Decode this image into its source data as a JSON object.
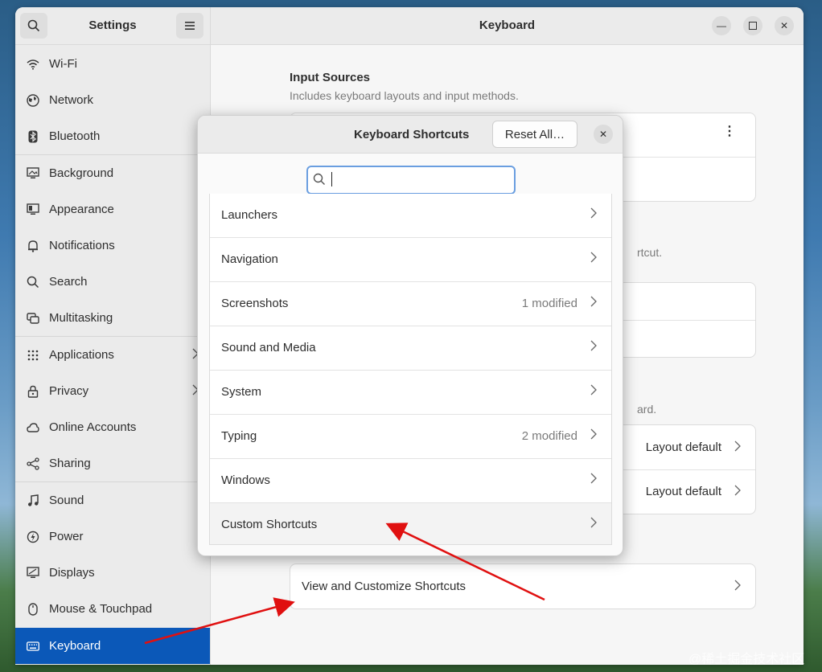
{
  "settings": {
    "sidebar_title": "Settings",
    "items": [
      {
        "label": "Wi-Fi",
        "icon": "wifi-icon"
      },
      {
        "label": "Network",
        "icon": "network-icon"
      },
      {
        "label": "Bluetooth",
        "icon": "bluetooth-icon"
      },
      {
        "label": "Background",
        "icon": "background-icon"
      },
      {
        "label": "Appearance",
        "icon": "appearance-icon"
      },
      {
        "label": "Notifications",
        "icon": "bell-icon"
      },
      {
        "label": "Search",
        "icon": "search-icon"
      },
      {
        "label": "Multitasking",
        "icon": "multitasking-icon"
      },
      {
        "label": "Applications",
        "icon": "grid-icon"
      },
      {
        "label": "Privacy",
        "icon": "lock-icon"
      },
      {
        "label": "Online Accounts",
        "icon": "cloud-icon"
      },
      {
        "label": "Sharing",
        "icon": "share-icon"
      },
      {
        "label": "Sound",
        "icon": "music-note-icon"
      },
      {
        "label": "Power",
        "icon": "power-icon"
      },
      {
        "label": "Displays",
        "icon": "display-icon"
      },
      {
        "label": "Mouse & Touchpad",
        "icon": "mouse-icon"
      },
      {
        "label": "Keyboard",
        "icon": "keyboard-icon"
      }
    ]
  },
  "main": {
    "title": "Keyboard",
    "input_sources_title": "Input Sources",
    "input_sources_subtitle": "Includes keyboard layouts and input methods.",
    "partial_text_1": "rtcut.",
    "partial_text_2": "ard.",
    "layout_default_1": "Layout default",
    "layout_default_2": "Layout default",
    "view_shortcuts": "View and Customize Shortcuts"
  },
  "dialog": {
    "title": "Keyboard Shortcuts",
    "reset_label": "Reset All…",
    "search_placeholder": "",
    "items": [
      {
        "label": "Launchers",
        "modified": ""
      },
      {
        "label": "Navigation",
        "modified": ""
      },
      {
        "label": "Screenshots",
        "modified": "1 modified"
      },
      {
        "label": "Sound and Media",
        "modified": ""
      },
      {
        "label": "System",
        "modified": ""
      },
      {
        "label": "Typing",
        "modified": "2 modified"
      },
      {
        "label": "Windows",
        "modified": ""
      },
      {
        "label": "Custom Shortcuts",
        "modified": ""
      }
    ]
  },
  "watermark": "@稀土掘金技术社区",
  "colors": {
    "accent": "#0b58b8",
    "annotation_arrow": "#e01010",
    "search_focus": "#6a9ee0"
  }
}
